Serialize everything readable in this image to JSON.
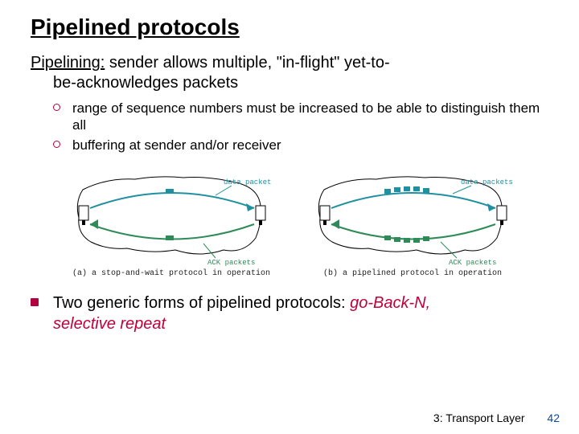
{
  "title": "Pipelined protocols",
  "lead": {
    "term": "Pipelining:",
    "rest1": " sender allows multiple, \"in-flight\" yet-to-",
    "rest2": "be-acknowledges packets"
  },
  "sub": [
    "range of sequence numbers must be increased to be able to distinguish them all",
    "buffering at sender and/or receiver"
  ],
  "figA": {
    "label_data": "data packet",
    "label_ack": "ACK packets",
    "caption": "(a) a stop-and-wait protocol in operation"
  },
  "figB": {
    "label_data": "data packets",
    "label_ack": "ACK packets",
    "caption": "(b) a pipelined protocol in operation"
  },
  "bottom": {
    "text1": "Two generic forms of pipelined protocols: ",
    "em1": "go-Back-N,",
    "em2": "selective repeat"
  },
  "footer": {
    "chapter": "3: Transport Layer",
    "page": "42"
  }
}
